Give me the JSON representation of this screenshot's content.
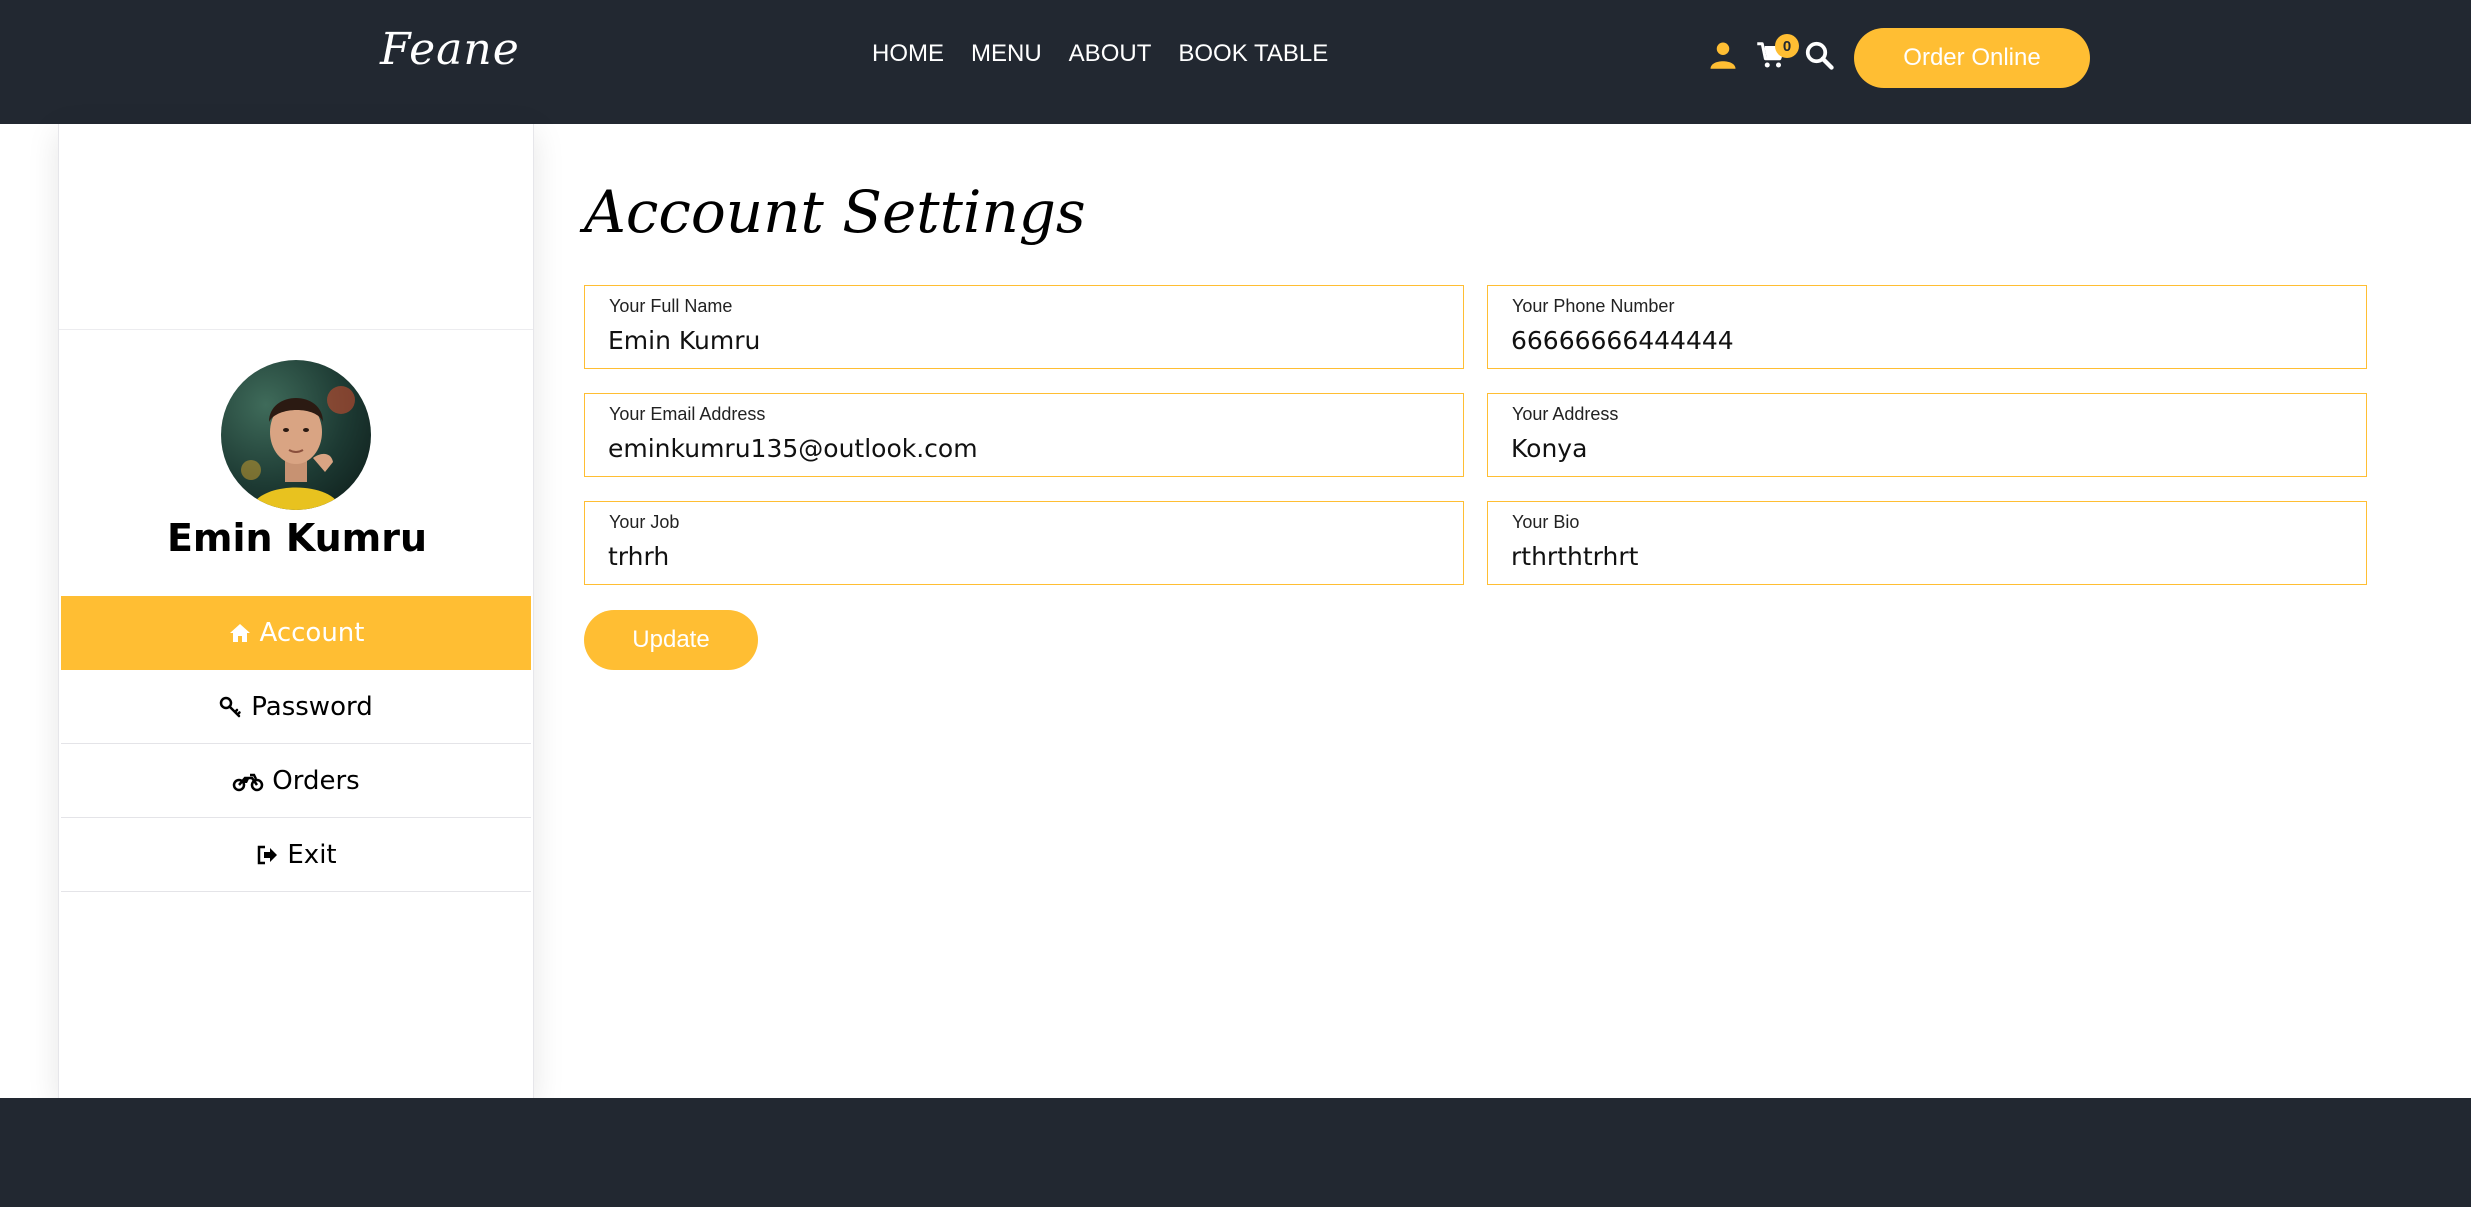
{
  "header": {
    "brand": "Feane",
    "nav": [
      "HOME",
      "MENU",
      "ABOUT",
      "BOOK TABLE"
    ],
    "cart_count": "0",
    "order_button": "Order Online"
  },
  "sidebar": {
    "profile_name": "Emin Kumru",
    "items": [
      {
        "label": "Account",
        "icon": "home-icon",
        "active": true
      },
      {
        "label": "Password",
        "icon": "key-icon",
        "active": false
      },
      {
        "label": "Orders",
        "icon": "motorcycle-icon",
        "active": false
      },
      {
        "label": "Exit",
        "icon": "sign-out-icon",
        "active": false
      }
    ]
  },
  "main": {
    "title": "Account Settings",
    "fields": {
      "full_name": {
        "label": "Your Full Name",
        "value": "Emin Kumru"
      },
      "phone": {
        "label": "Your Phone Number",
        "value": "66666666444444"
      },
      "email": {
        "label": "Your Email Address",
        "value": "eminkumru135@outlook.com"
      },
      "address": {
        "label": "Your Address",
        "value": "Konya"
      },
      "job": {
        "label": "Your Job",
        "value": "trhrh"
      },
      "bio": {
        "label": "Your Bio",
        "value": "rthrthtrhrt"
      }
    },
    "update_button": "Update"
  },
  "colors": {
    "accent": "#ffbe33",
    "dark": "#222831"
  }
}
